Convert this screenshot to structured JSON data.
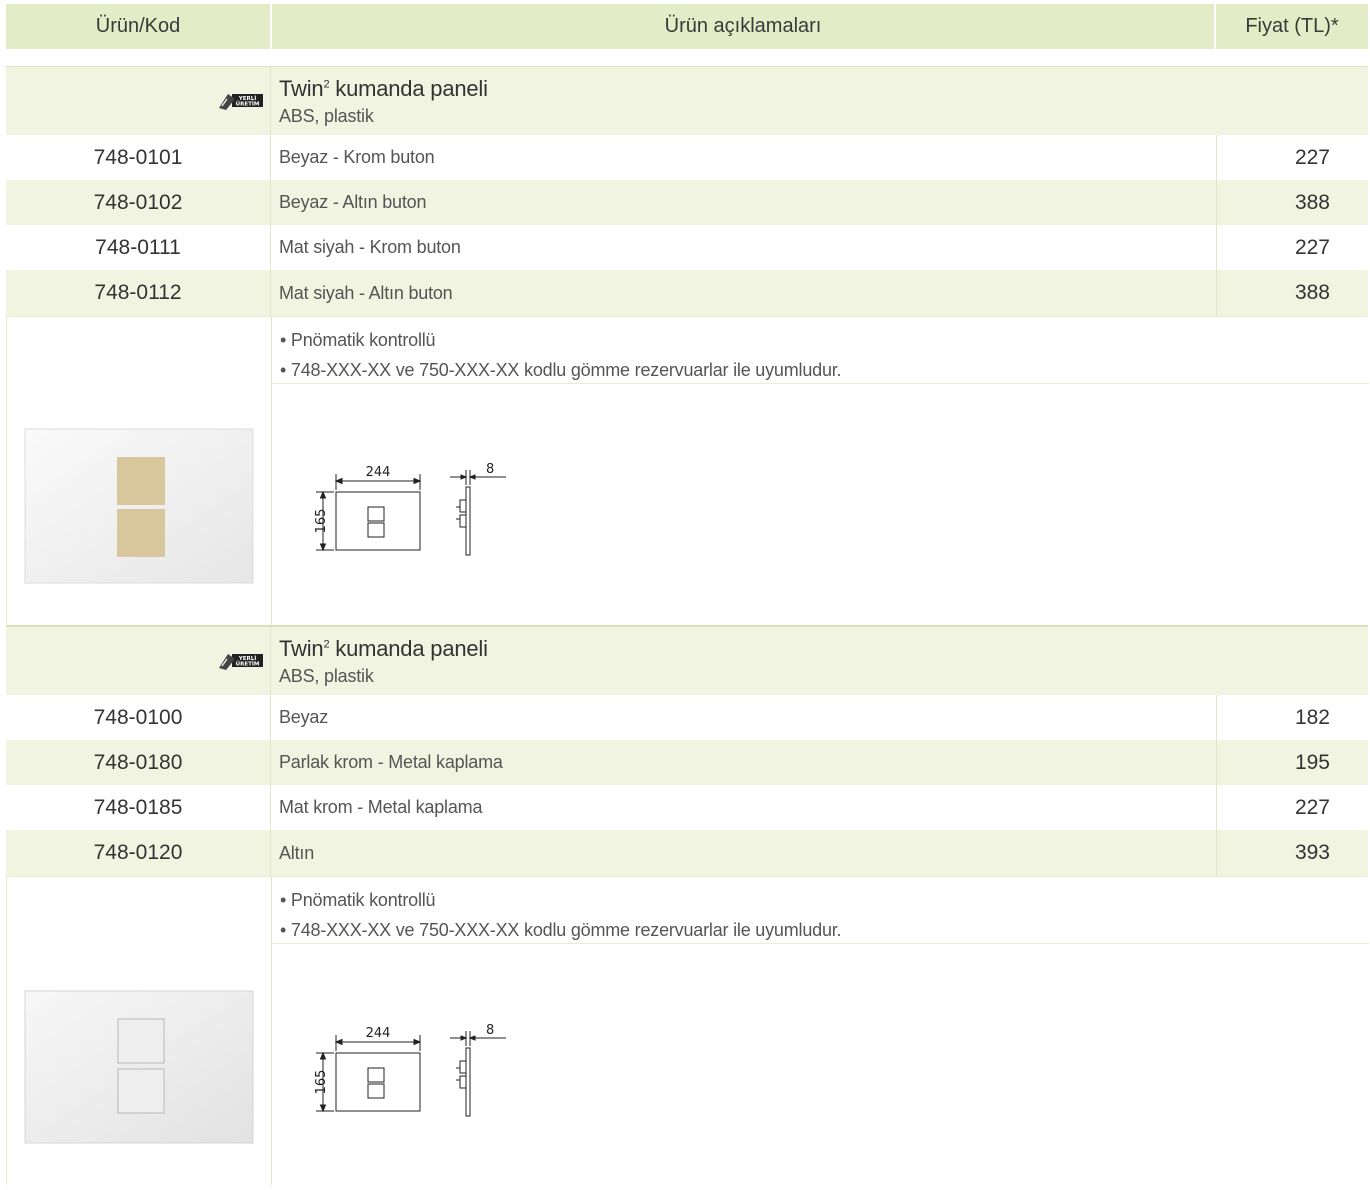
{
  "header": {
    "col_code": "Ürün/Kod",
    "col_desc": "Ürün açıklamaları",
    "col_price": "Fiyat (TL)*"
  },
  "sections": [
    {
      "title": "Twin",
      "title_sup": "2",
      "title_rest": " kumanda paneli",
      "subtitle": "ABS, plastik",
      "badge_text": "YERLİ ÜRETİM",
      "rows": [
        {
          "code": "748-0101",
          "desc": "Beyaz - Krom buton",
          "price": "227"
        },
        {
          "code": "748-0102",
          "desc": "Beyaz - Altın buton",
          "price": "388"
        },
        {
          "code": "748-0111",
          "desc": "Mat siyah - Krom buton",
          "price": "227"
        },
        {
          "code": "748-0112",
          "desc": "Mat siyah - Altın buton",
          "price": "388"
        }
      ],
      "notes": [
        "• Pnömatik kontrollü",
        "• 748-XXX-XX ve 750-XXX-XX kodlu gömme rezervuarlar ile uyumludur."
      ],
      "dims": {
        "width": "244",
        "height": "165",
        "depth": "8"
      },
      "button_color": "#d8c79c"
    },
    {
      "title": "Twin",
      "title_sup": "2",
      "title_rest": " kumanda paneli",
      "subtitle": "ABS, plastik",
      "badge_text": "YERLİ ÜRETİM",
      "rows": [
        {
          "code": "748-0100",
          "desc": "Beyaz",
          "price": "182"
        },
        {
          "code": "748-0180",
          "desc": "Parlak krom - Metal kaplama",
          "price": "195"
        },
        {
          "code": "748-0185",
          "desc": "Mat krom - Metal kaplama",
          "price": "227"
        },
        {
          "code": "748-0120",
          "desc": "Altın",
          "price": "393"
        }
      ],
      "notes": [
        "• Pnömatik kontrollü",
        "• 748-XXX-XX ve 750-XXX-XX kodlu gömme rezervuarlar ile uyumludur."
      ],
      "dims": {
        "width": "244",
        "height": "165",
        "depth": "8"
      },
      "button_color": "#eeeeee"
    }
  ]
}
